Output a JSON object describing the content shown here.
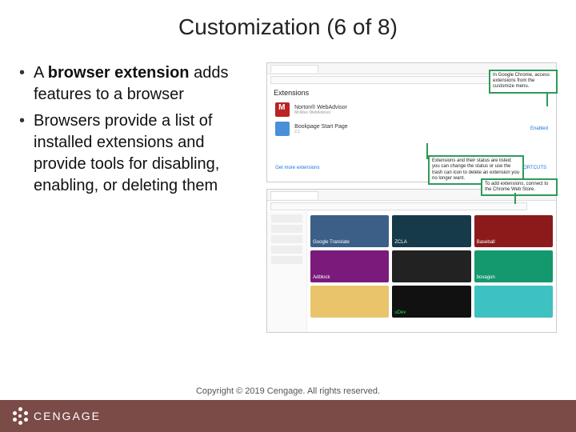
{
  "title": "Customization (6 of 8)",
  "bullets": {
    "b1_pre": "A ",
    "b1_bold": "browser extension",
    "b1_post": " adds features to a browser",
    "b2": "Browsers provide a list of installed extensions and provide tools for disabling, enabling, or deleting them"
  },
  "win1": {
    "heading": "Extensions",
    "ext1_name": "Norton® WebAdvisor",
    "ext1_sub": "McAfee WebAdvisor",
    "ext2_name": "Bookpage Start Page",
    "ext2_sub": "2.1",
    "ext2_status": "Enabled",
    "more_link": "Get more extensions"
  },
  "callouts": {
    "c1": "In Google Chrome, access extensions from the customize menu.",
    "c2": "Extensions and their status are listed; you can change the status or use the trash can icon to delete an extension you no longer want.",
    "c3": "To add extensions, connect to the Chrome Web Store."
  },
  "store": {
    "keyboard_link": "KEYBOARD SHORTCUTS",
    "tiles": {
      "t1": "Google Translate",
      "t2": "ZCLA",
      "t3": "Baseball",
      "t4": "Adblock",
      "t5": "",
      "t6": "boxagon",
      "t7": "",
      "t8": "uDev",
      "t9": ""
    }
  },
  "footer": {
    "brand": "CENGAGE",
    "copyright": "Copyright © 2019 Cengage. All rights reserved."
  }
}
